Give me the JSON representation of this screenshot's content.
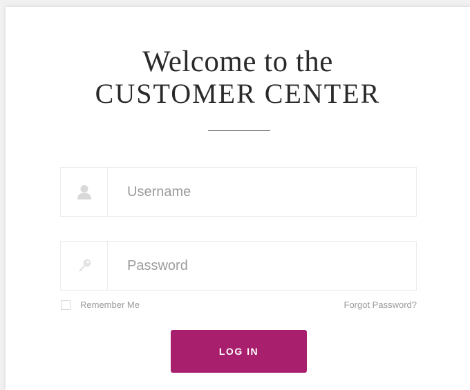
{
  "header": {
    "title_line1": "Welcome to the",
    "title_line2": "CUSTOMER CENTER"
  },
  "form": {
    "username": {
      "placeholder": "Username",
      "value": "",
      "icon": "user-icon"
    },
    "password": {
      "placeholder": "Password",
      "value": "",
      "icon": "key-icon"
    },
    "remember_label": "Remember Me",
    "remember_checked": false,
    "forgot_label": "Forgot Password?",
    "login_label": "LOG IN"
  },
  "colors": {
    "accent": "#a8206d",
    "title": "#2a2a2a",
    "muted_text": "#9a9a9a",
    "field_border": "#ececec",
    "icon": "#d9d9d9"
  }
}
